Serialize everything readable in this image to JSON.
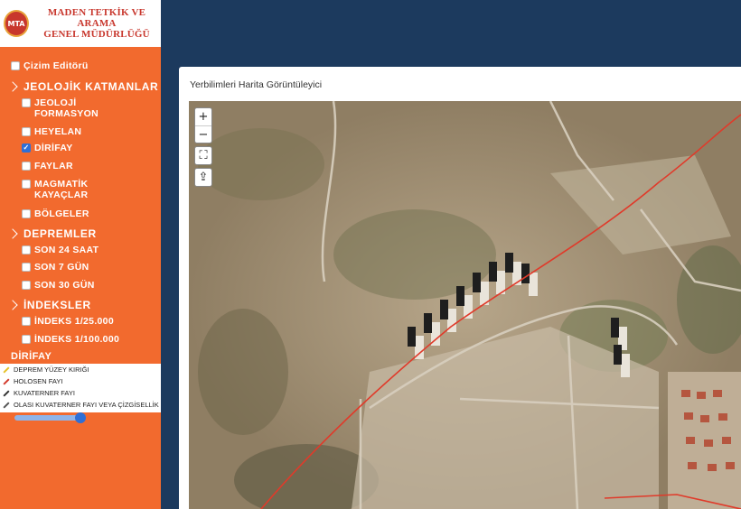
{
  "logo": {
    "seal_text": "MTA",
    "line1": "MADEN TETKİK VE ARAMA",
    "line2": "GENEL MÜDÜRLÜĞÜ"
  },
  "sidebar": {
    "drawing_editor": "Çizim Editörü",
    "geology": {
      "title": "JEOLOJİK KATMANLAR",
      "items": [
        {
          "label_line1": "JEOLOJİ",
          "label_line2": "FORMASYON",
          "checked": false
        },
        {
          "label_line1": "HEYELAN",
          "checked": false
        },
        {
          "label_line1": "DİRİFAY",
          "checked": true
        },
        {
          "label_line1": "FAYLAR",
          "checked": false
        },
        {
          "label_line1": "MAGMATİK",
          "label_line2": "KAYAÇLAR",
          "checked": false
        },
        {
          "label_line1": "BÖLGELER",
          "checked": false
        }
      ]
    },
    "earthquakes": {
      "title": "DEPREMLER",
      "items": [
        {
          "label": "SON 24 SAAT",
          "checked": false
        },
        {
          "label": "SON 7 GÜN",
          "checked": false
        },
        {
          "label": "SON 30 GÜN",
          "checked": false
        }
      ]
    },
    "indexes": {
      "title": "İNDEKSLER",
      "items": [
        {
          "label": "İNDEKS 1/25.000",
          "checked": false
        },
        {
          "label": "İNDEKS 1/100.000",
          "checked": false
        }
      ]
    },
    "legend": {
      "title": "DİRİFAY",
      "items": [
        {
          "label": "DEPREM YÜZEY KIRIĞI",
          "color": "#e6c229"
        },
        {
          "label": "HOLOSEN FAYI",
          "color": "#d33a2c"
        },
        {
          "label": "KUVATERNER FAYI",
          "color": "#333333"
        },
        {
          "label": "OLASI KUVATERNER FAYI VEYA ÇİZGİSELLİK",
          "color": "#555555"
        }
      ],
      "opacity": 1.0
    }
  },
  "panel": {
    "title": "Yerbilimleri Harita Görüntüleyici"
  },
  "map": {
    "zoom_in": "+",
    "zoom_out": "−",
    "fullscreen": "⛶",
    "share": "⇪",
    "fault_color": "#e03a2a"
  }
}
